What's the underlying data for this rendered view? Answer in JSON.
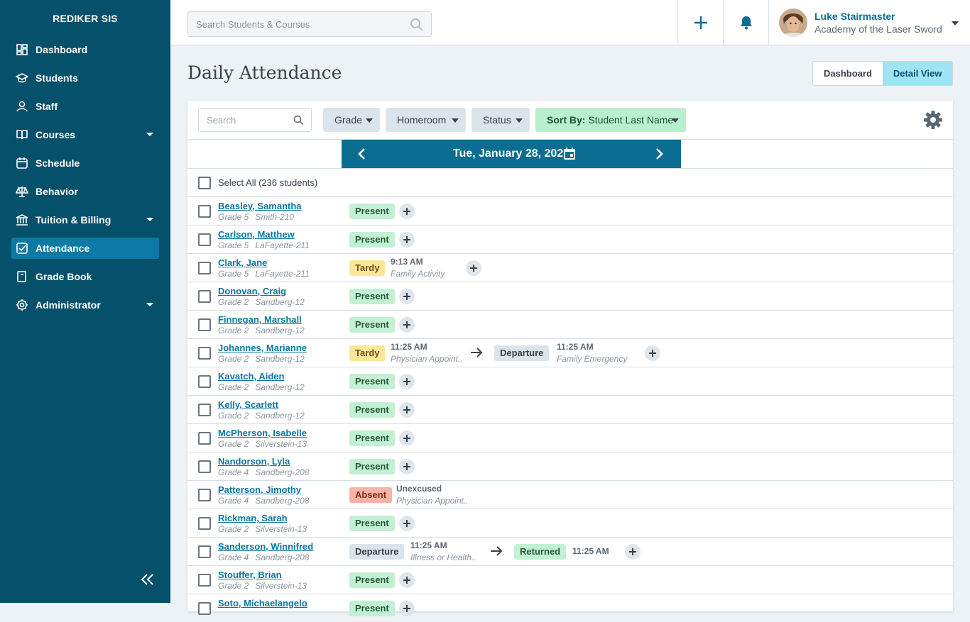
{
  "brand": "REDIKER SIS",
  "nav": {
    "dashboard": "Dashboard",
    "students": "Students",
    "staff": "Staff",
    "courses": "Courses",
    "schedule": "Schedule",
    "behavior": "Behavior",
    "tuition": "Tuition & Billing",
    "attendance": "Attendance",
    "gradebook": "Grade Book",
    "administrator": "Administrator"
  },
  "topbar": {
    "search_placeholder": "Search Students & Courses",
    "user_name": "Luke Stairmaster",
    "school": "Academy of the Laser Sword"
  },
  "page": {
    "title": "Daily Attendance",
    "view_dashboard": "Dashboard",
    "view_detail": "Detail View"
  },
  "filters": {
    "search_placeholder": "Search",
    "grade": "Grade",
    "homeroom": "Homeroom",
    "status": "Status",
    "sort_label": "Sort By:",
    "sort_value": "Student Last Name"
  },
  "date": "Tue, January 28, 2020",
  "select_all": "Select All (236 students)",
  "students": [
    {
      "name": "Beasley, Samantha",
      "grade": "Grade 5",
      "room": "Smith-210",
      "status": "Present"
    },
    {
      "name": "Carlson, Matthew",
      "grade": "Grade 5",
      "room": "LaFayette-211",
      "status": "Present"
    },
    {
      "name": "Clark, Jane",
      "grade": "Grade 5",
      "room": "LaFayette-211",
      "status": "Tardy",
      "time": "9:13 AM",
      "reason": "Family Activity"
    },
    {
      "name": "Donovan, Craig",
      "grade": "Grade 2",
      "room": "Sandberg-12",
      "status": "Present"
    },
    {
      "name": "Finnegan, Marshall",
      "grade": "Grade 2",
      "room": "Sandberg-12",
      "status": "Present"
    },
    {
      "name": "Johannes, Marianne",
      "grade": "Grade 2",
      "room": "Sandberg-12",
      "status": "Tardy",
      "time": "11:25 AM",
      "reason": "Physician Appoint..",
      "status2": "Departure",
      "time2": "11:25 AM",
      "reason2": "Family Emergency"
    },
    {
      "name": "Kavatch, Aiden",
      "grade": "Grade 2",
      "room": "Sandberg-12",
      "status": "Present"
    },
    {
      "name": "Kelly, Scarlett",
      "grade": "Grade 2",
      "room": "Sandberg-12",
      "status": "Present"
    },
    {
      "name": "McPherson, Isabelle",
      "grade": "Grade 2",
      "room": "Silverstein-13",
      "status": "Present"
    },
    {
      "name": "Nandorson, Lyla",
      "grade": "Grade 4",
      "room": "Sandberg-208",
      "status": "Present"
    },
    {
      "name": "Patterson, Jimothy",
      "grade": "Grade 4",
      "room": "Sandberg-208",
      "status": "Absent",
      "time": "Unexcused",
      "reason": "Physician Appoint.."
    },
    {
      "name": "Rickman, Sarah",
      "grade": "Grade 2",
      "room": "Silverstein-13",
      "status": "Present"
    },
    {
      "name": "Sanderson, Winnifred",
      "grade": "Grade 4",
      "room": "Sandberg-208",
      "status": "Departure",
      "time": "11:25 AM",
      "reason": "Illness or Health..",
      "status2": "Returned",
      "time2": "11:25 AM"
    },
    {
      "name": "Stouffer, Brian",
      "grade": "Grade 2",
      "room": "Silverstein-13",
      "status": "Present"
    },
    {
      "name": "Soto, Michaelangelo",
      "grade": "",
      "room": "",
      "status": "Present"
    }
  ],
  "colors": {
    "sidebar": "#05506b",
    "sidebar_active": "#0d79a5",
    "accent": "#0b6d92",
    "present": "#c2f0d3",
    "tardy": "#fde69a",
    "absent": "#f6b4a8",
    "departure": "#dbe4ea"
  },
  "icons": {
    "nav": [
      "dashboard-icon",
      "students-icon",
      "staff-icon",
      "courses-icon",
      "schedule-icon",
      "behavior-icon",
      "tuition-icon",
      "attendance-icon",
      "gradebook-icon",
      "administrator-icon"
    ],
    "topbar": [
      "search-icon",
      "plus-icon",
      "bell-icon",
      "chevron-down-icon"
    ],
    "panel": [
      "gear-icon",
      "chevron-left-icon",
      "chevron-right-icon",
      "calendar-icon",
      "arrow-right-icon",
      "collapse-sidebar-icon"
    ]
  }
}
